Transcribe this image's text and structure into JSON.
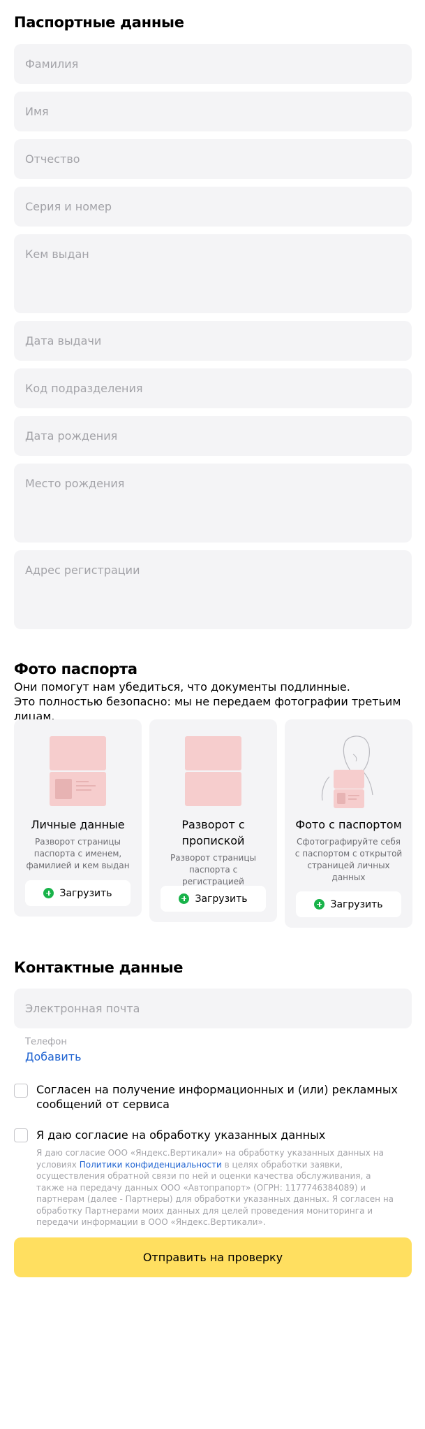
{
  "passport": {
    "title": "Паспортные данные",
    "fields": {
      "last_name": "Фамилия",
      "first_name": "Имя",
      "patronymic": "Отчество",
      "series_number": "Серия и номер",
      "issued_by": "Кем выдан",
      "issue_date": "Дата выдачи",
      "division_code": "Код подразделения",
      "birth_date": "Дата рождения",
      "birth_place": "Место рождения",
      "registration_address": "Адрес регистрации"
    }
  },
  "photos": {
    "title": "Фото паспорта",
    "subtitle_line1": "Они помогут нам убедиться, что документы подлинные.",
    "subtitle_line2": "Это полностью безопасно: мы не передаем фотографии третьим лицам.",
    "cards": [
      {
        "title": "Личные данные",
        "desc": "Разворот страницы паспорта с именем, фамилией и кем выдан",
        "button": "Загрузить",
        "icon": "passport-personal-page-icon"
      },
      {
        "title": "Разворот с пропиской",
        "desc": "Разворот страницы паспорта с регистрацией",
        "button": "Загрузить",
        "icon": "passport-registration-page-icon"
      },
      {
        "title": "Фото с паспортом",
        "desc": "Сфотографируйте себя с паспортом с открытой страницей личных данных",
        "button": "Загрузить",
        "icon": "selfie-with-passport-icon"
      }
    ]
  },
  "contacts": {
    "title": "Контактные данные",
    "email_placeholder": "Электронная почта",
    "phone_label": "Телефон",
    "phone_add": "Добавить"
  },
  "consents": {
    "marketing": "Согласен на получение информационных и (или) рекламных сообщений от сервиса",
    "processing": "Я даю согласие на обработку указанных данных",
    "legal_before_link": "Я даю согласие ООО «Яндекс.Вертикали» на обработку указанных данных на условиях ",
    "legal_link": "Политики конфиденциальности",
    "legal_after_link": " в целях обработки заявки, осуществления обратной связи по ней и оценки качества обслуживания, а также на передачу данных ООО «Автопрапорт» (ОГРН: 1177746384089) и партнерам (далее - Партнеры) для обработки указанных данных. Я согласен на обработку Партнерами моих данных для целей проведения мониторинга и передачи информации в ООО «Яндекс.Вертикали»."
  },
  "submit_label": "Отправить на проверку",
  "colors": {
    "field_bg": "#f4f4f6",
    "accent_yellow": "#ffdf60",
    "upload_green": "#19b34a",
    "link_blue": "#1f63d1"
  }
}
